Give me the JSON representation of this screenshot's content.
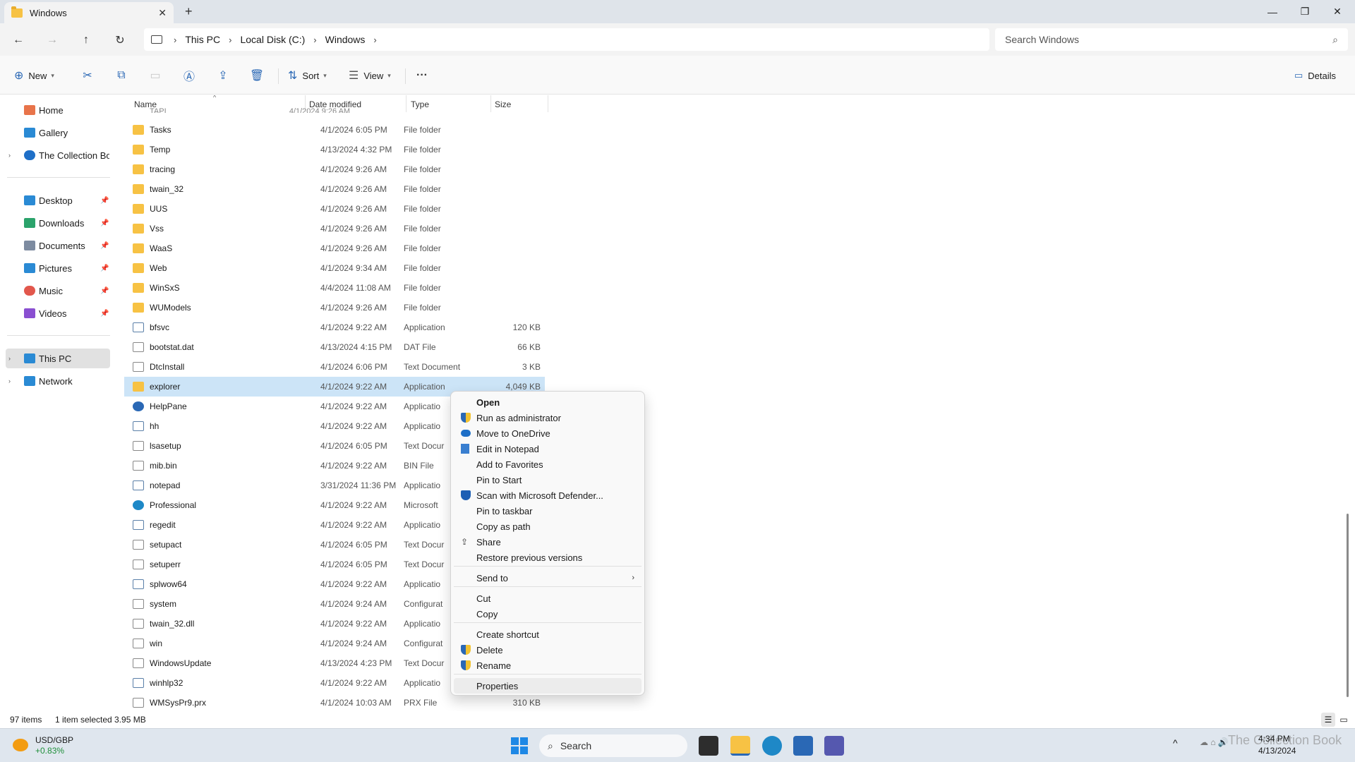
{
  "window": {
    "tab_title": "Windows",
    "close_tab": "✕",
    "new_tab": "+",
    "minimize": "—",
    "restore": "❐",
    "close": "✕"
  },
  "address": {
    "back": "←",
    "forward": "→",
    "up": "↑",
    "refresh": "↻",
    "breadcrumbs": [
      "This PC",
      "Local Disk (C:)",
      "Windows"
    ],
    "separator": "›",
    "search_placeholder": "Search Windows",
    "search_icon": "⌕"
  },
  "commandbar": {
    "new_label": "New",
    "sort_label": "Sort",
    "view_label": "View",
    "more_label": "···",
    "details_label": "Details",
    "icons": {
      "new": "⊕",
      "cut": "✂",
      "copy": "⧉",
      "paste": "▭",
      "rename": "Ⓐ",
      "share": "⇪",
      "delete": "🗑",
      "sort": "⇅",
      "view": "☰",
      "details": "▭"
    }
  },
  "sidebar": {
    "quick": [
      {
        "label": "Home",
        "color": "#e8744a"
      },
      {
        "label": "Gallery",
        "color": "#2a8ad4"
      },
      {
        "label": "The Collection Boo",
        "color": "#1e6fc7"
      }
    ],
    "pinned": [
      {
        "label": "Desktop",
        "color": "#2a8ad4",
        "pin": "📌"
      },
      {
        "label": "Downloads",
        "color": "#2ba36b",
        "pin": "📌"
      },
      {
        "label": "Documents",
        "color": "#7d8ba0",
        "pin": "📌"
      },
      {
        "label": "Pictures",
        "color": "#2a8ad4",
        "pin": "📌"
      },
      {
        "label": "Music",
        "color": "#e2574c",
        "pin": "📌"
      },
      {
        "label": "Videos",
        "color": "#8a4fd1",
        "pin": "📌"
      }
    ],
    "devices": [
      {
        "label": "This PC",
        "color": "#2a8ad4"
      },
      {
        "label": "Network",
        "color": "#2a8ad4"
      }
    ],
    "expand_glyph": "›"
  },
  "columns": {
    "name": "Name",
    "date": "Date modified",
    "type": "Type",
    "size": "Size"
  },
  "files": [
    {
      "name": "Tasks",
      "date": "4/1/2024 6:05 PM",
      "type": "File folder",
      "size": "",
      "icon": "folder"
    },
    {
      "name": "Temp",
      "date": "4/13/2024 4:32 PM",
      "type": "File folder",
      "size": "",
      "icon": "folder"
    },
    {
      "name": "tracing",
      "date": "4/1/2024 9:26 AM",
      "type": "File folder",
      "size": "",
      "icon": "folder"
    },
    {
      "name": "twain_32",
      "date": "4/1/2024 9:26 AM",
      "type": "File folder",
      "size": "",
      "icon": "folder"
    },
    {
      "name": "UUS",
      "date": "4/1/2024 9:26 AM",
      "type": "File folder",
      "size": "",
      "icon": "folder"
    },
    {
      "name": "Vss",
      "date": "4/1/2024 9:26 AM",
      "type": "File folder",
      "size": "",
      "icon": "folder"
    },
    {
      "name": "WaaS",
      "date": "4/1/2024 9:26 AM",
      "type": "File folder",
      "size": "",
      "icon": "folder"
    },
    {
      "name": "Web",
      "date": "4/1/2024 9:34 AM",
      "type": "File folder",
      "size": "",
      "icon": "folder"
    },
    {
      "name": "WinSxS",
      "date": "4/4/2024 11:08 AM",
      "type": "File folder",
      "size": "",
      "icon": "folder"
    },
    {
      "name": "WUModels",
      "date": "4/1/2024 9:26 AM",
      "type": "File folder",
      "size": "",
      "icon": "folder"
    },
    {
      "name": "bfsvc",
      "date": "4/1/2024 9:22 AM",
      "type": "Application",
      "size": "120 KB",
      "icon": "app"
    },
    {
      "name": "bootstat.dat",
      "date": "4/13/2024 4:15 PM",
      "type": "DAT File",
      "size": "66 KB",
      "icon": "doc"
    },
    {
      "name": "DtcInstall",
      "date": "4/1/2024 6:06 PM",
      "type": "Text Document",
      "size": "3 KB",
      "icon": "doc"
    },
    {
      "name": "explorer",
      "date": "4/1/2024 9:22 AM",
      "type": "Application",
      "size": "4,049 KB",
      "icon": "folder",
      "selected": true
    },
    {
      "name": "HelpPane",
      "date": "4/1/2024 9:22 AM",
      "type": "Applicatio",
      "size": "",
      "icon": "help"
    },
    {
      "name": "hh",
      "date": "4/1/2024 9:22 AM",
      "type": "Applicatio",
      "size": "",
      "icon": "app"
    },
    {
      "name": "lsasetup",
      "date": "4/1/2024 6:05 PM",
      "type": "Text Docur",
      "size": "",
      "icon": "doc"
    },
    {
      "name": "mib.bin",
      "date": "4/1/2024 9:22 AM",
      "type": "BIN File",
      "size": "",
      "icon": "doc"
    },
    {
      "name": "notepad",
      "date": "3/31/2024 11:36 PM",
      "type": "Applicatio",
      "size": "",
      "icon": "app"
    },
    {
      "name": "Professional",
      "date": "4/1/2024 9:22 AM",
      "type": "Microsoft",
      "size": "",
      "icon": "web"
    },
    {
      "name": "regedit",
      "date": "4/1/2024 9:22 AM",
      "type": "Applicatio",
      "size": "",
      "icon": "app"
    },
    {
      "name": "setupact",
      "date": "4/1/2024 6:05 PM",
      "type": "Text Docur",
      "size": "",
      "icon": "doc"
    },
    {
      "name": "setuperr",
      "date": "4/1/2024 6:05 PM",
      "type": "Text Docur",
      "size": "",
      "icon": "doc"
    },
    {
      "name": "splwow64",
      "date": "4/1/2024 9:22 AM",
      "type": "Applicatio",
      "size": "",
      "icon": "app"
    },
    {
      "name": "system",
      "date": "4/1/2024 9:24 AM",
      "type": "Configurat",
      "size": "",
      "icon": "cfg"
    },
    {
      "name": "twain_32.dll",
      "date": "4/1/2024 9:22 AM",
      "type": "Applicatio",
      "size": "",
      "icon": "doc"
    },
    {
      "name": "win",
      "date": "4/1/2024 9:24 AM",
      "type": "Configurat",
      "size": "",
      "icon": "cfg"
    },
    {
      "name": "WindowsUpdate",
      "date": "4/13/2024 4:23 PM",
      "type": "Text Docur",
      "size": "",
      "icon": "doc"
    },
    {
      "name": "winhlp32",
      "date": "4/1/2024 9:22 AM",
      "type": "Applicatio",
      "size": "",
      "icon": "app"
    },
    {
      "name": "WMSysPr9.prx",
      "date": "4/1/2024 10:03 AM",
      "type": "PRX File",
      "size": "310 KB",
      "icon": "doc"
    }
  ],
  "context_menu": {
    "items": [
      {
        "label": "Open",
        "icon": "",
        "bold": true
      },
      {
        "label": "Run as administrator",
        "icon": "shield"
      },
      {
        "label": "Move to OneDrive",
        "icon": "cloud"
      },
      {
        "label": "Edit in Notepad",
        "icon": "notepad"
      },
      {
        "label": "Add to Favorites",
        "icon": ""
      },
      {
        "label": "Pin to Start",
        "icon": ""
      },
      {
        "label": "Scan with Microsoft Defender...",
        "icon": "defender"
      },
      {
        "label": "Pin to taskbar",
        "icon": ""
      },
      {
        "label": "Copy as path",
        "icon": ""
      },
      {
        "label": "Share",
        "icon": "share"
      },
      {
        "label": "Restore previous versions",
        "icon": ""
      },
      {
        "label": "Send to",
        "icon": "",
        "submenu": true
      },
      {
        "label": "Cut",
        "icon": ""
      },
      {
        "label": "Copy",
        "icon": ""
      },
      {
        "label": "Create shortcut",
        "icon": ""
      },
      {
        "label": "Delete",
        "icon": "shield"
      },
      {
        "label": "Rename",
        "icon": "shield"
      },
      {
        "label": "Properties",
        "icon": "",
        "hover": true
      }
    ],
    "submenu_arrow": "›"
  },
  "status": {
    "items_count": "97 items",
    "selection": "1 item selected  3.95 MB",
    "details_view_icon": "☰",
    "tiles_view_icon": "▭"
  },
  "taskbar": {
    "widget_title": "USD/GBP",
    "widget_value": "+0.83%",
    "widget_value_color": "#1f8f3a",
    "search_label": "Search",
    "time": "4:34 PM",
    "date": "4/13/2024",
    "tray_overflow": "^",
    "tray_icons": "☁ ⌂ 🔊",
    "watermark": "The Collection Book"
  }
}
